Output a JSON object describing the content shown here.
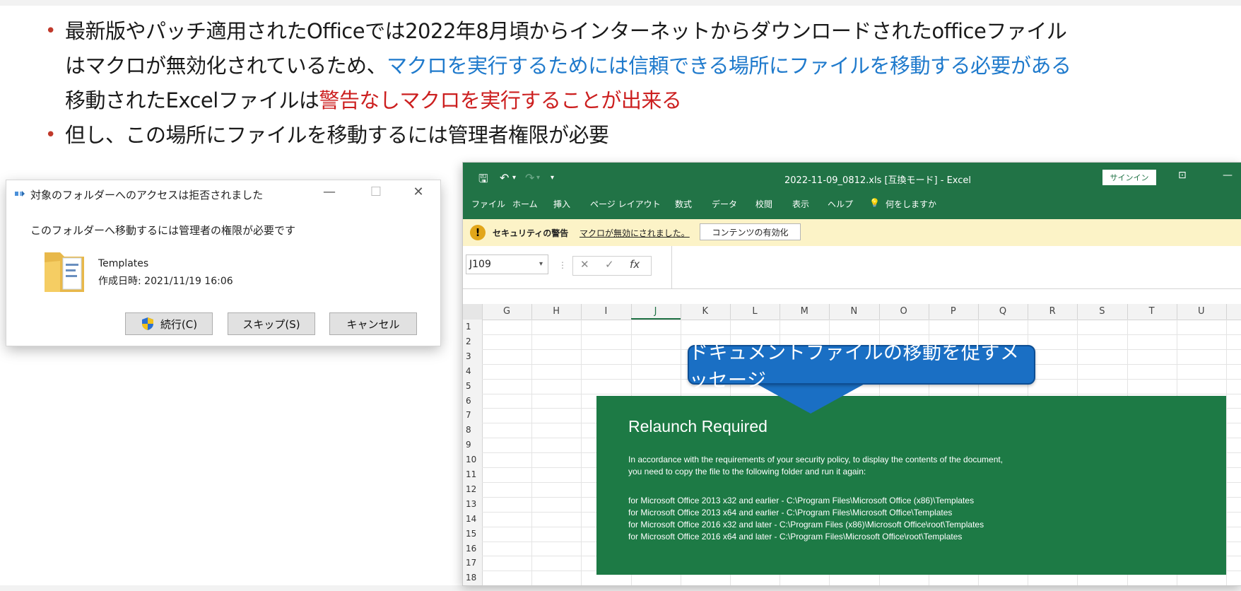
{
  "bullets": {
    "b1_line1": "最新版やパッチ適用されたOfficeでは2022年8月頃からインターネットからダウンロードされたofficeファイル",
    "b1_line2_black": "はマクロが無効化されているため、",
    "b1_line2_blue": "マクロを実行するためには信頼できる場所にファイルを移動する必要がある",
    "b1_line3_black": "移動されたExcelファイルは",
    "b1_line3_red": "警告なしマクロを実行することが出来る",
    "b2": "但し、この場所にファイルを移動するには管理者権限が必要"
  },
  "dialog": {
    "title": "対象のフォルダーへのアクセスは拒否されました",
    "message": "このフォルダーへ移動するには管理者の権限が必要です",
    "folder_name": "Templates",
    "folder_date": "作成日時: 2021/11/19 16:06",
    "buttons": {
      "continue": "続行(C)",
      "skip": "スキップ(S)",
      "cancel": "キャンセル"
    },
    "controls": {
      "minimize": "—",
      "maximize": "☐",
      "close": "✕"
    }
  },
  "excel": {
    "title": "2022-11-09_0812.xls [互換モード] - Excel",
    "signin": "サインイン",
    "tabs": [
      "ファイル",
      "ホーム",
      "挿入",
      "ページ レイアウト",
      "数式",
      "データ",
      "校閲",
      "表示",
      "ヘルプ",
      "何をしますか"
    ],
    "security": {
      "label": "セキュリティの警告",
      "message": "マクロが無効にされました。",
      "button": "コンテンツの有効化"
    },
    "namebox": "J109",
    "fx": "fx",
    "columns": [
      "G",
      "H",
      "I",
      "J",
      "K",
      "L",
      "M",
      "N",
      "O",
      "P",
      "Q",
      "R",
      "S",
      "T",
      "U"
    ],
    "selected_column": "J",
    "rows": [
      "1",
      "2",
      "3",
      "4",
      "5",
      "6",
      "7",
      "8",
      "9",
      "10",
      "11",
      "12",
      "13",
      "14",
      "15",
      "16",
      "17",
      "18"
    ]
  },
  "relaunch": {
    "title": "Relaunch Required",
    "body1": "In accordance with the requirements of your security policy, to display the contents of the document,",
    "body2": "you need to copy the file to the following folder and run it again:",
    "line1": "for Microsoft Office 2013 x32 and earlier - C:\\Program Files\\Microsoft Office (x86)\\Templates",
    "line2": "for Microsoft Office 2013 x64 and earlier - C:\\Program Files\\Microsoft Office\\Templates",
    "line3": "for Microsoft Office 2016 x32 and later - C:\\Program Files (x86)\\Microsoft Office\\root\\Templates",
    "line4": "for Microsoft Office 2016 x64 and later - C:\\Program Files\\Microsoft Office\\root\\Templates"
  },
  "callout": {
    "text": "ドキュメントファイルの移動を促すメッセージ"
  },
  "colors": {
    "excel_green": "#217346",
    "relaunch_green": "#1d7a45",
    "callout_blue": "#1a6fc4",
    "highlight_blue": "#1f7acc",
    "highlight_red": "#cc1f1f"
  }
}
